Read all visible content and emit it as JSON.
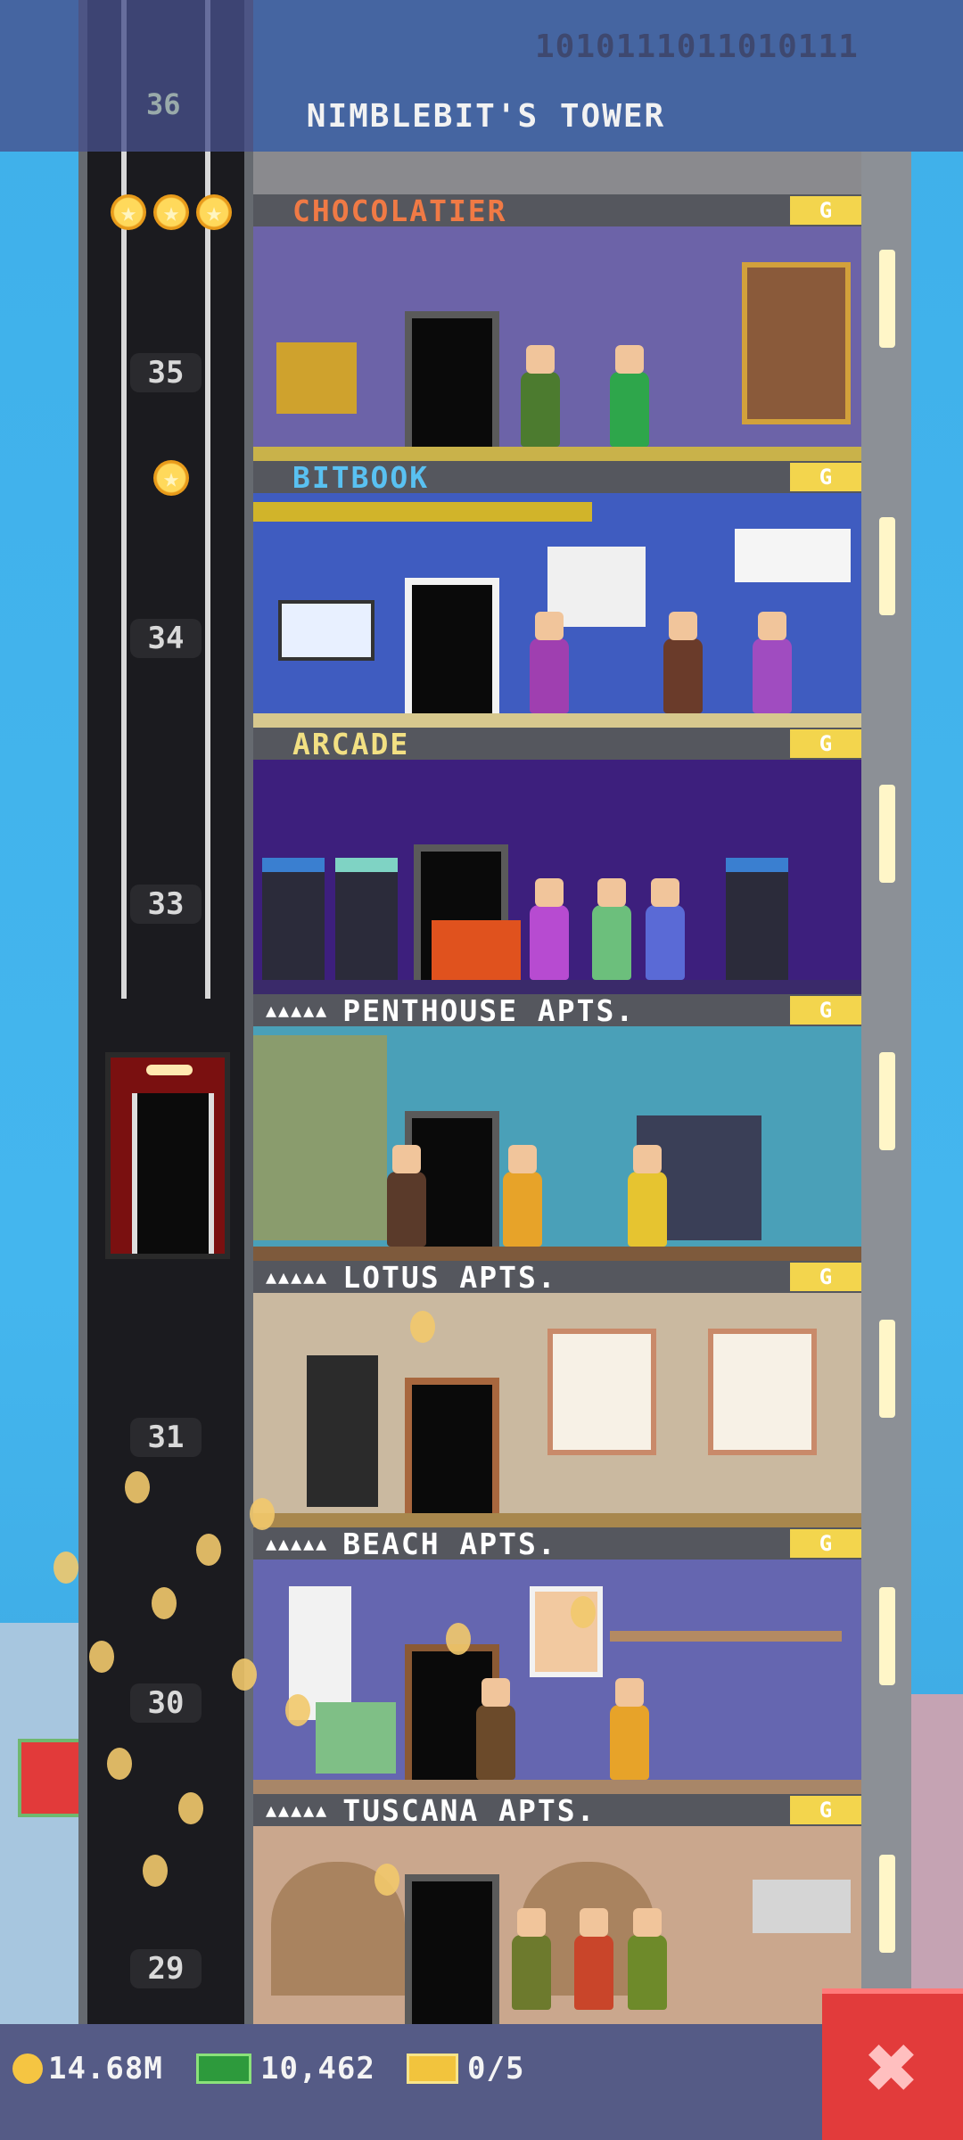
{
  "top_banner": {
    "tower_name": "NIMBLEBIT'S TOWER",
    "binary_text": "1010111011010111",
    "floor_label": "36"
  },
  "floors": [
    {
      "name": "CHOCOLATIER",
      "stars": "",
      "name_color": "#f07a45",
      "room_color": "#6c63a8",
      "g_label": "G"
    },
    {
      "name": "BITBOOK",
      "stars": "",
      "name_color": "#59c1f2",
      "room_color": "#3f5cc0",
      "g_label": "G"
    },
    {
      "name": "ARCADE",
      "stars": "",
      "name_color": "#f2e083",
      "room_color": "#3d1f7d",
      "g_label": "G"
    },
    {
      "name": "PENTHOUSE APTS.",
      "stars": "▲▲▲▲▲",
      "name_color": "#ffffff",
      "room_color": "#4aa0b8",
      "g_label": "G"
    },
    {
      "name": "LOTUS APTS.",
      "stars": "▲▲▲▲▲",
      "name_color": "#ffffff",
      "room_color": "#cab9a0",
      "g_label": "G"
    },
    {
      "name": "BEACH APTS.",
      "stars": "▲▲▲▲▲",
      "name_color": "#ffffff",
      "room_color": "#6566b0",
      "g_label": "G"
    },
    {
      "name": "TUSCANA APTS.",
      "stars": "▲▲▲▲▲",
      "name_color": "#ffffff",
      "room_color": "#caa78d",
      "g_label": "G"
    }
  ],
  "elevator": {
    "floor_numbers": [
      "35",
      "34",
      "33",
      "31",
      "30",
      "29"
    ],
    "stars_row1": [
      "★",
      "★",
      "★"
    ],
    "stars_row2": [
      "★"
    ]
  },
  "status_bar": {
    "coins": "14.68M",
    "bux": "10,462",
    "tickets": "0/5",
    "close_label": "✖"
  }
}
